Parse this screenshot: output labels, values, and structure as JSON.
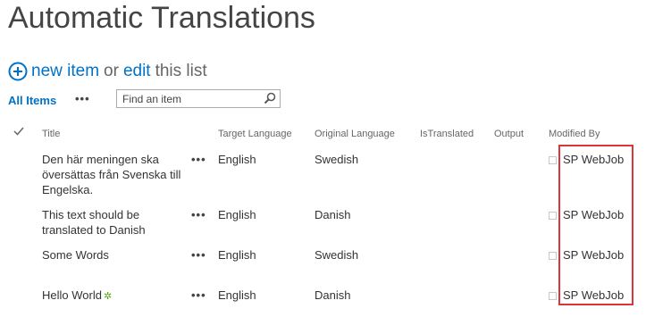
{
  "page": {
    "title": "Automatic Translations"
  },
  "commands": {
    "new_item": "new item",
    "or_text": "or",
    "edit": "edit",
    "this_list": "this list"
  },
  "view": {
    "all_items": "All Items",
    "more": "•••",
    "search_placeholder": "Find an item"
  },
  "columns": {
    "title": "Title",
    "target_language": "Target Language",
    "original_language": "Original Language",
    "is_translated": "IsTranslated",
    "output": "Output",
    "modified_by": "Modified By"
  },
  "rows": [
    {
      "title": "Den här meningen ska översättas från Svenska till Engelska.",
      "menu": "•••",
      "target_language": "English",
      "original_language": "Swedish",
      "modified_by": "SP WebJob"
    },
    {
      "title": "This text should be translated to Danish",
      "menu": "•••",
      "target_language": "English",
      "original_language": "Danish",
      "modified_by": "SP WebJob"
    },
    {
      "title": "Some Words",
      "menu": "•••",
      "target_language": "English",
      "original_language": "Swedish",
      "modified_by": "SP WebJob"
    },
    {
      "title": "Hello World",
      "menu": "•••",
      "target_language": "English",
      "original_language": "Danish",
      "modified_by": "SP WebJob",
      "new_badge": "✲"
    }
  ],
  "colors": {
    "accent": "#0072c6",
    "highlight": "#d9373a",
    "new_badge": "#58a51a"
  }
}
